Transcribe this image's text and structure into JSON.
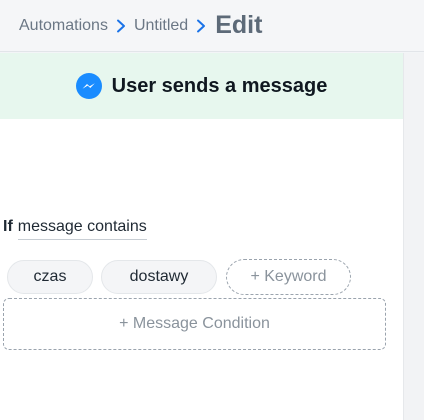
{
  "breadcrumb": {
    "items": [
      "Automations",
      "Untitled"
    ],
    "current": "Edit"
  },
  "trigger": {
    "icon": "messenger-icon",
    "title": "User sends a message"
  },
  "condition": {
    "if_label": "If",
    "selector": "message contains",
    "keywords": [
      "czas",
      "dostawy"
    ],
    "add_keyword_label": "+ Keyword"
  },
  "add_condition_label": "+ Message Condition",
  "colors": {
    "accent_link": "#1a73e8",
    "trigger_bg": "#e7f7ee",
    "messenger_blue": "#1a8cff"
  }
}
